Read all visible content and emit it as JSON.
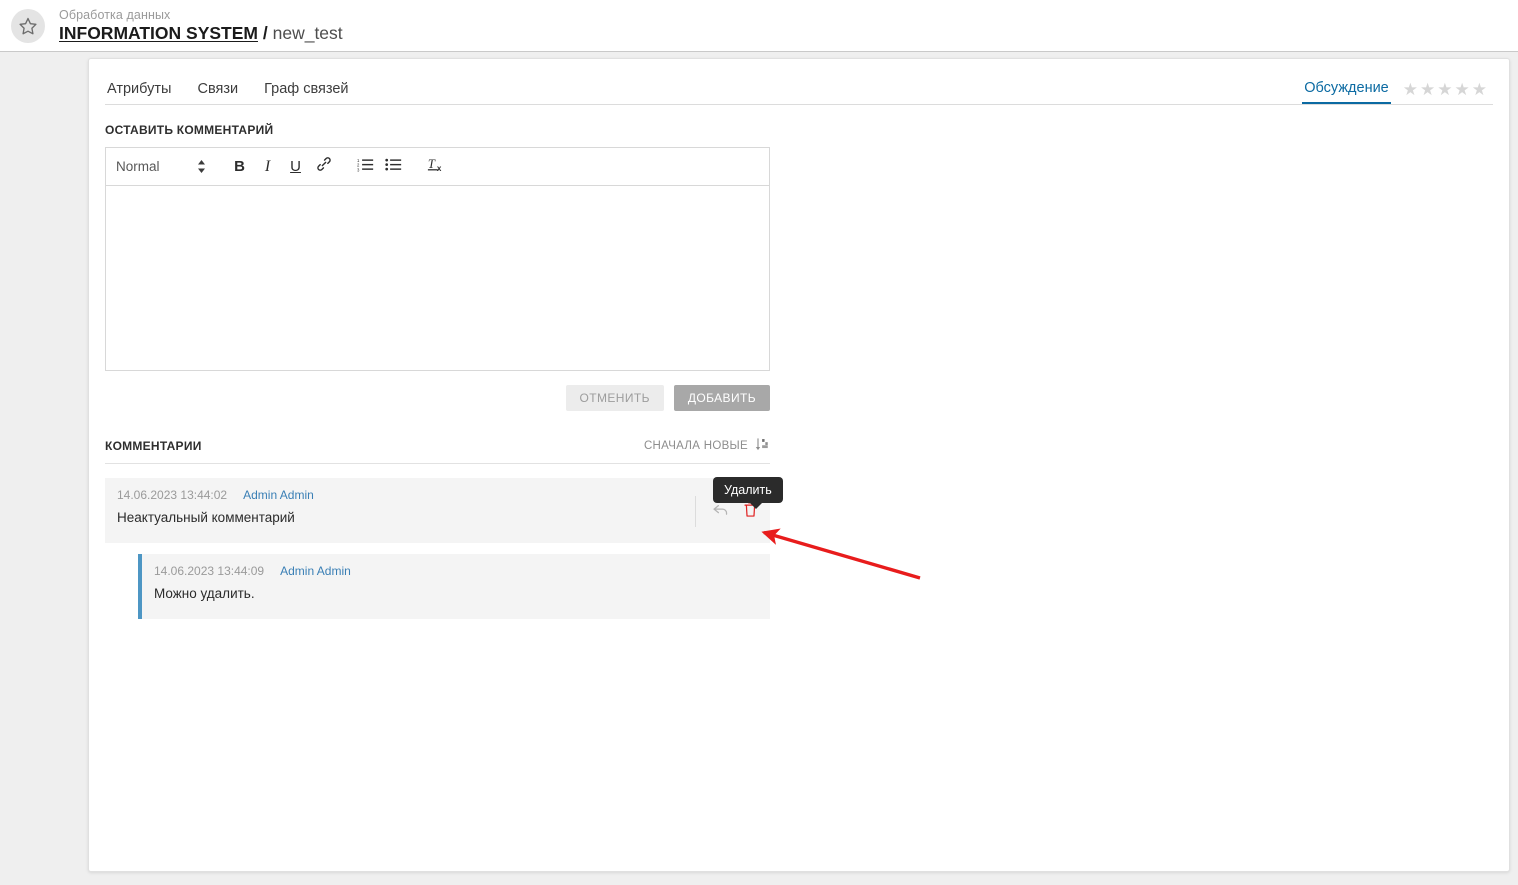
{
  "header": {
    "favorite_icon": "star-outline-icon",
    "breadcrumb_small": "Обработка данных",
    "breadcrumb_system": "INFORMATION SYSTEM",
    "breadcrumb_separator": "/",
    "breadcrumb_leaf": "new_test"
  },
  "tabs": {
    "items": [
      {
        "label": "Атрибуты"
      },
      {
        "label": "Связи"
      },
      {
        "label": "Граф связей"
      }
    ],
    "active_right": "Обсуждение",
    "rating": {
      "total": 5,
      "filled": 0,
      "glyph": "★"
    }
  },
  "form": {
    "label": "ОСТАВИТЬ КОММЕНТАРИЙ",
    "toolbar": {
      "format_value": "Normal",
      "bold": "B",
      "italic": "I",
      "underline": "U",
      "link_icon": "link-icon",
      "ordered_list_icon": "ordered-list-icon",
      "bullet_list_icon": "bullet-list-icon",
      "clear_format_icon": "clear-formatting-icon"
    },
    "editor_value": "",
    "editor_placeholder": "",
    "cancel_label": "ОТМЕНИТЬ",
    "submit_label": "ДОБАВИТЬ"
  },
  "comments": {
    "title": "КОММЕНТАРИИ",
    "sort_label": "СНАЧАЛА НОВЫЕ",
    "sort_icon": "sort-descending-icon",
    "items": [
      {
        "date": "14.06.2023 13:44:02",
        "author": "Admin Admin",
        "text": "Неактуальный комментарий",
        "reply_icon": "reply-arrow-icon",
        "delete_icon": "trash-icon"
      },
      {
        "date": "14.06.2023 13:44:09",
        "author": "Admin Admin",
        "text": "Можно удалить."
      }
    ]
  },
  "tooltip": {
    "text": "Удалить"
  },
  "colors": {
    "accent": "#0b6aa2",
    "reply_border": "#4d96c4",
    "delete": "#e02020",
    "annotation": "#e81c1c"
  }
}
